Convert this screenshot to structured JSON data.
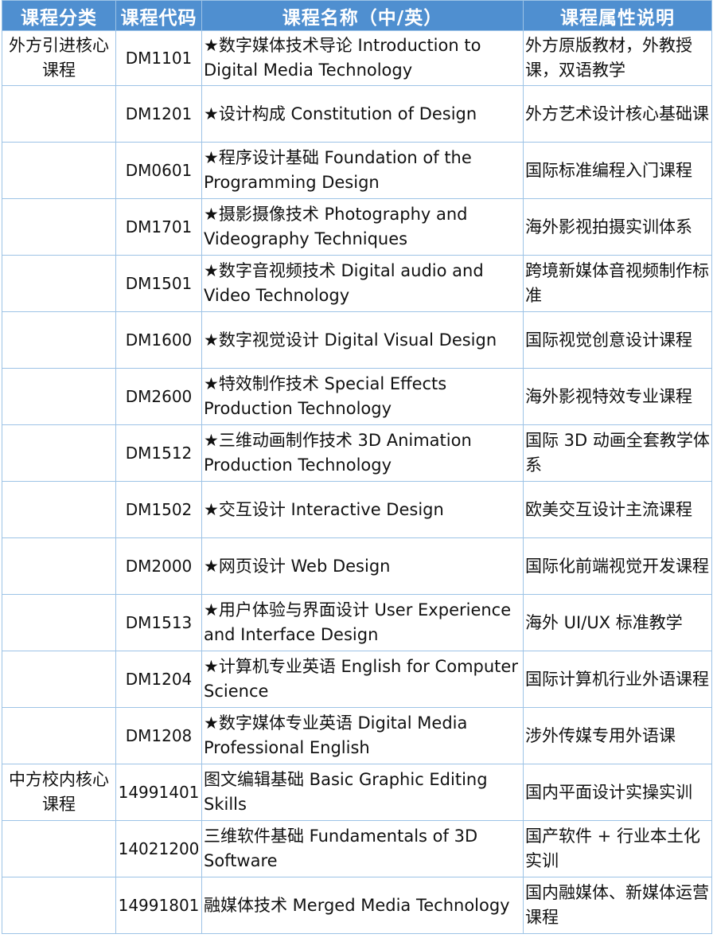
{
  "table": {
    "headers": [
      "课程分类",
      "课程代码",
      "课程名称（中/英）",
      "课程属性说明"
    ],
    "rows": [
      {
        "category": "外方引进核心课程",
        "code": "DM1101",
        "name": "★数字媒体技术导论 Introduction to Digital Media Technology",
        "attribute": "外方原版教材，外教授课，双语教学"
      },
      {
        "category": "",
        "code": "DM1201",
        "name": "★设计构成 Constitution of Design",
        "attribute": "外方艺术设计核心基础课"
      },
      {
        "category": "",
        "code": "DM0601",
        "name": "★程序设计基础 Foundation of the Programming Design",
        "attribute": "国际标准编程入门课程"
      },
      {
        "category": "",
        "code": "DM1701",
        "name": "★摄影摄像技术 Photography and Videography Techniques",
        "attribute": "海外影视拍摄实训体系"
      },
      {
        "category": "",
        "code": "DM1501",
        "name": "★数字音视频技术 Digital audio and Video Technology",
        "attribute": "跨境新媒体音视频制作标准"
      },
      {
        "category": "",
        "code": "DM1600",
        "name": "★数字视觉设计 Digital Visual Design",
        "attribute": "国际视觉创意设计课程"
      },
      {
        "category": "",
        "code": "DM2600",
        "name": "★特效制作技术 Special Effects Production Technology",
        "attribute": "海外影视特效专业课程"
      },
      {
        "category": "",
        "code": "DM1512",
        "name": "★三维动画制作技术 3D Animation Production Technology",
        "attribute": "国际 3D 动画全套教学体系"
      },
      {
        "category": "",
        "code": "DM1502",
        "name": "★交互设计 Interactive Design",
        "attribute": "欧美交互设计主流课程"
      },
      {
        "category": "",
        "code": "DM2000",
        "name": "★网页设计 Web Design",
        "attribute": "国际化前端视觉开发课程"
      },
      {
        "category": "",
        "code": "DM1513",
        "name": "★用户体验与界面设计 User Experience and Interface Design",
        "attribute": "海外 UI/UX 标准教学"
      },
      {
        "category": "",
        "code": "DM1204",
        "name": "★计算机专业英语 English for Computer Science",
        "attribute": "国际计算机行业外语课程"
      },
      {
        "category": "",
        "code": "DM1208",
        "name": "★数字媒体专业英语 Digital Media Professional English",
        "attribute": "涉外传媒专用外语课"
      },
      {
        "category": "中方校内核心课程",
        "code": "14991401",
        "name": "图文编辑基础 Basic Graphic Editing Skills",
        "attribute": "国内平面设计实操实训"
      },
      {
        "category": "",
        "code": "14021200",
        "name": "三维软件基础 Fundamentals of 3D Software",
        "attribute": "国产软件 + 行业本土化实训"
      },
      {
        "category": "",
        "code": "14991801",
        "name": "融媒体技术 Merged Media Technology",
        "attribute": "国内融媒体、新媒体运营课程"
      }
    ]
  }
}
